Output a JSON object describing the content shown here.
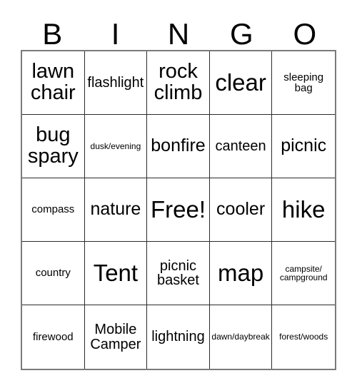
{
  "card": {
    "title": "BINGO",
    "header_letters": [
      "B",
      "I",
      "N",
      "G",
      "O"
    ],
    "free_space_label": "Free!",
    "colors": {
      "background": "#ffffff",
      "text": "#000000",
      "cell_border": "#2b2b2b",
      "outer_border": "#7a7a7a"
    },
    "grid_size": "5x5",
    "rows": [
      [
        {
          "text": "lawn chair",
          "size": "lg"
        },
        {
          "text": "flashlight",
          "size": "sm"
        },
        {
          "text": "rock climb",
          "size": "lg"
        },
        {
          "text": "clear",
          "size": "xl"
        },
        {
          "text": "sleeping bag",
          "size": "xs"
        }
      ],
      [
        {
          "text": "bug spary",
          "size": "lg"
        },
        {
          "text": "dusk/evening",
          "size": "xxs"
        },
        {
          "text": "bonfire",
          "size": "md"
        },
        {
          "text": "canteen",
          "size": "sm"
        },
        {
          "text": "picnic",
          "size": "md"
        }
      ],
      [
        {
          "text": "compass",
          "size": "xs"
        },
        {
          "text": "nature",
          "size": "md"
        },
        {
          "text": "Free!",
          "size": "xl"
        },
        {
          "text": "cooler",
          "size": "md"
        },
        {
          "text": "hike",
          "size": "xl"
        }
      ],
      [
        {
          "text": "country",
          "size": "xs"
        },
        {
          "text": "Tent",
          "size": "xl"
        },
        {
          "text": "picnic basket",
          "size": "sm"
        },
        {
          "text": "map",
          "size": "xl"
        },
        {
          "text": "campsite/ campground",
          "size": "xxs"
        }
      ],
      [
        {
          "text": "firewood",
          "size": "xs"
        },
        {
          "text": "Mobile Camper",
          "size": "sm"
        },
        {
          "text": "lightning",
          "size": "sm"
        },
        {
          "text": "dawn/daybreak",
          "size": "xxs"
        },
        {
          "text": "forest/woods",
          "size": "xxs"
        }
      ]
    ]
  }
}
